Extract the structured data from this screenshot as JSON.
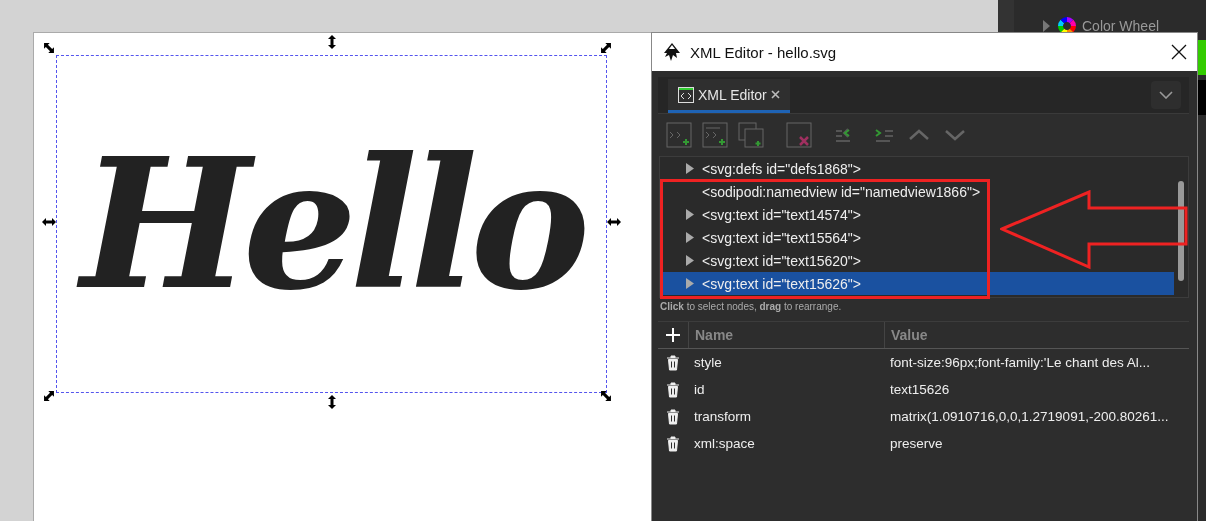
{
  "canvas": {
    "artwork_text": "Hello"
  },
  "side_panel": {
    "item": {
      "label": "Color Wheel",
      "expanded": false
    }
  },
  "window": {
    "title": "XML Editor - hello.svg"
  },
  "tabs": [
    {
      "label": "XML Editor",
      "selected": true
    }
  ],
  "tree": {
    "rows": [
      {
        "label": "<svg:defs id=\"defs1868\">",
        "expandable": true,
        "selected": false
      },
      {
        "label": "<sodipodi:namedview id=\"namedview1866\">",
        "expandable": false,
        "selected": false
      },
      {
        "label": "<svg:text id=\"text14574\">",
        "expandable": true,
        "selected": false
      },
      {
        "label": "<svg:text id=\"text15564\">",
        "expandable": true,
        "selected": false
      },
      {
        "label": "<svg:text id=\"text15620\">",
        "expandable": true,
        "selected": false
      },
      {
        "label": "<svg:text id=\"text15626\">",
        "expandable": true,
        "selected": true
      }
    ],
    "hint": "**Click** to select nodes, **drag** to rearrange."
  },
  "attributes": {
    "columns": [
      "Name",
      "Value"
    ],
    "rows": [
      {
        "name": "style",
        "value": "font-size:96px;font-family:'Le chant des Al..."
      },
      {
        "name": "id",
        "value": "text15626"
      },
      {
        "name": "transform",
        "value": "matrix(1.0910716,0,0,1.2719091,-200.80261..."
      },
      {
        "name": "xml:space",
        "value": "preserve"
      }
    ]
  }
}
